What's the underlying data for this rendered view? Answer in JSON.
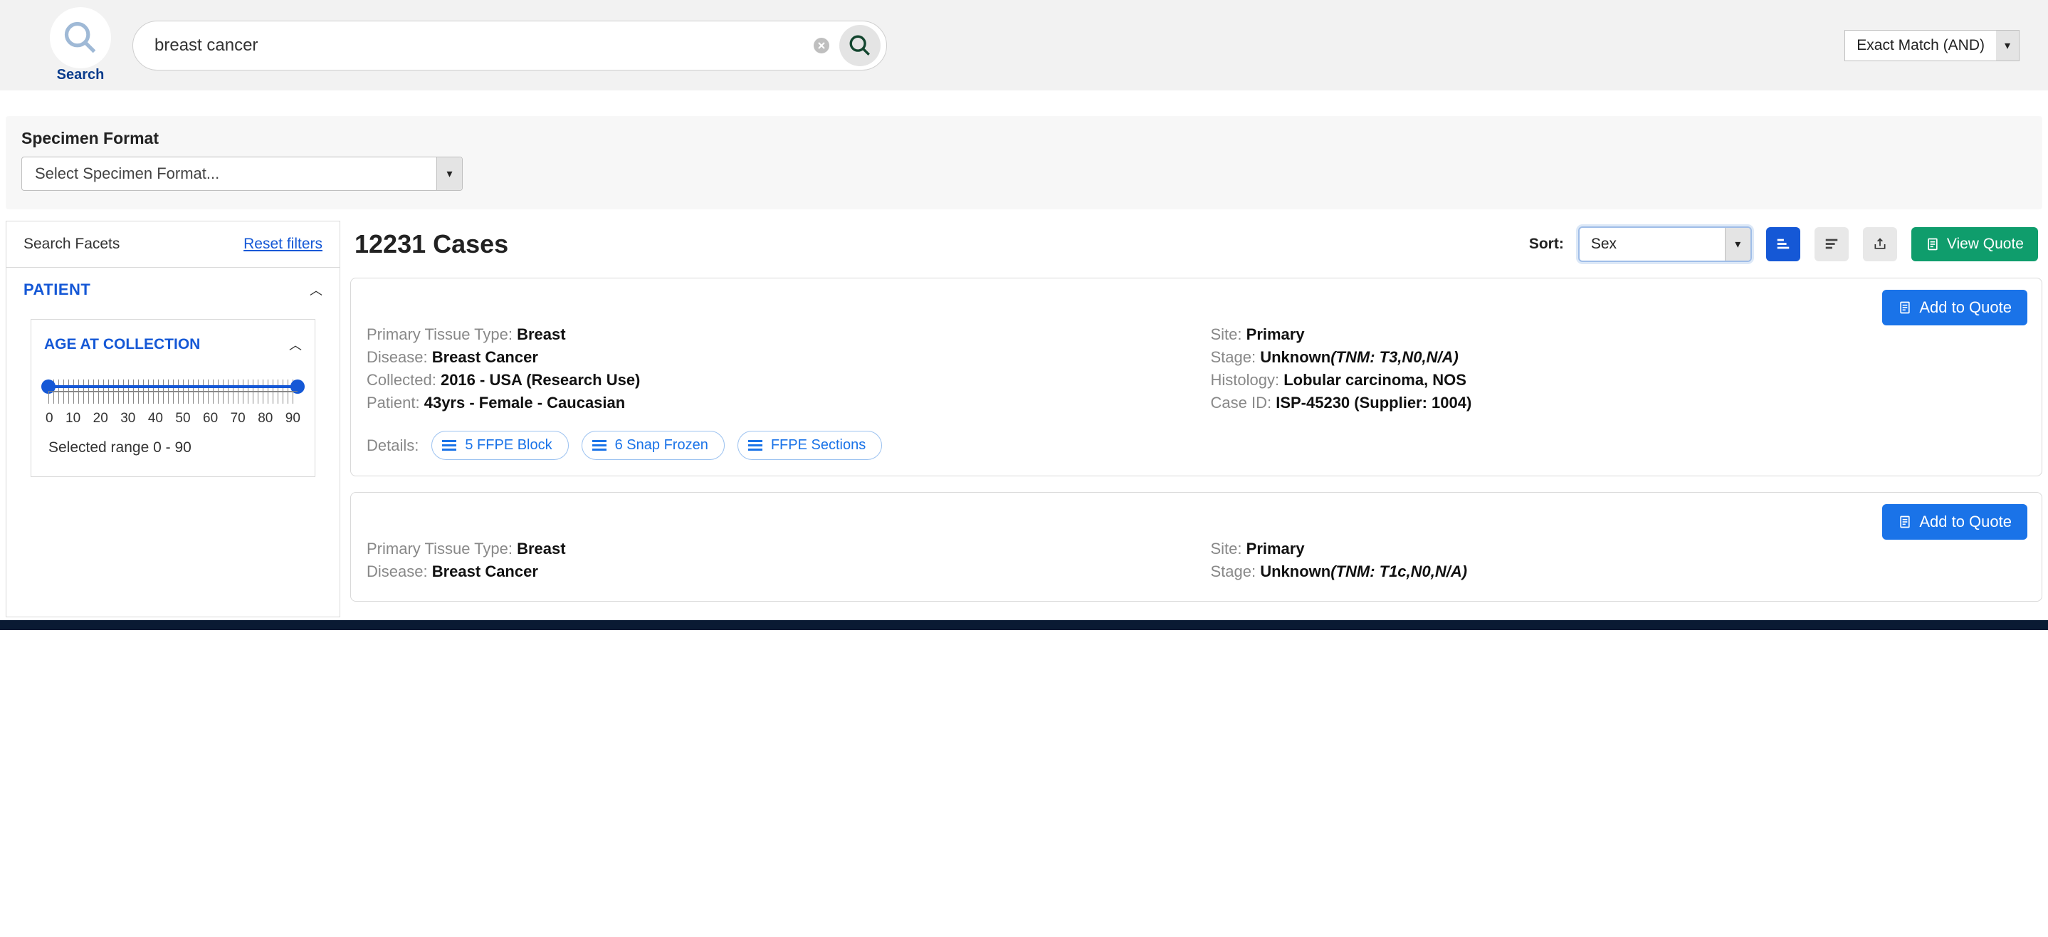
{
  "header": {
    "search_app_label": "Search",
    "search_value": "breast cancer",
    "match_mode": "Exact Match (AND)"
  },
  "specimen": {
    "title": "Specimen Format",
    "placeholder": "Select Specimen Format..."
  },
  "facets": {
    "title": "Search Facets",
    "reset": "Reset filters",
    "patient_section": "PATIENT",
    "age_section": "AGE AT COLLECTION",
    "age_ticks": [
      "0",
      "10",
      "20",
      "30",
      "40",
      "50",
      "60",
      "70",
      "80",
      "90"
    ],
    "age_range_text": "Selected range 0 - 90"
  },
  "results": {
    "count_label": "12231 Cases",
    "sort_label": "Sort:",
    "sort_value": "Sex",
    "view_quote": "View Quote",
    "add_to_quote": "Add to Quote",
    "details_label": "Details:",
    "cases": [
      {
        "left": [
          {
            "k": "Primary Tissue Type: ",
            "v": "Breast"
          },
          {
            "k": "Disease: ",
            "v": "Breast Cancer"
          },
          {
            "k": "Collected: ",
            "v": "2016 - USA (Research Use)"
          },
          {
            "k": "Patient: ",
            "v": "43yrs - Female - Caucasian"
          }
        ],
        "right": [
          {
            "k": "Site: ",
            "v": "Primary"
          },
          {
            "k": "Stage: ",
            "v": "Unknown",
            "suffix": "(TNM: T3,N0,N/A)"
          },
          {
            "k": "Histology: ",
            "v": "Lobular carcinoma, NOS"
          },
          {
            "k": "Case ID: ",
            "v": "ISP-45230 (Supplier: 1004)"
          }
        ],
        "chips": [
          "5 FFPE Block",
          "6 Snap Frozen",
          "FFPE Sections"
        ]
      },
      {
        "left": [
          {
            "k": "Primary Tissue Type: ",
            "v": "Breast"
          },
          {
            "k": "Disease: ",
            "v": "Breast Cancer"
          }
        ],
        "right": [
          {
            "k": "Site: ",
            "v": "Primary"
          },
          {
            "k": "Stage: ",
            "v": "Unknown",
            "suffix": "(TNM: T1c,N0,N/A)"
          }
        ],
        "chips": []
      }
    ]
  }
}
